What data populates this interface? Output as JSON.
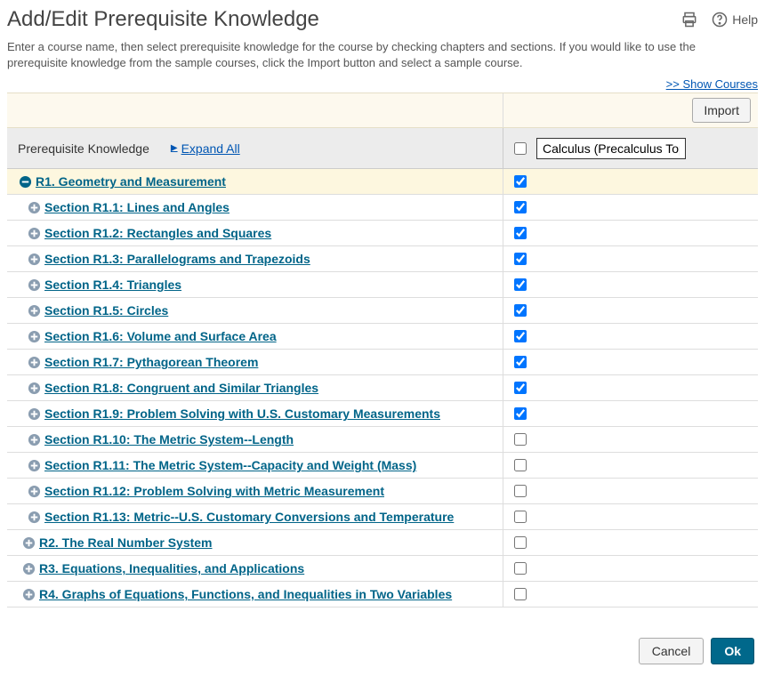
{
  "title": "Add/Edit Prerequisite Knowledge",
  "help_label": "Help",
  "description": "Enter a course name, then select prerequisite knowledge for the course by checking chapters and sections. If you would like to use the prerequisite knowledge from the sample courses, click the Import button and select a sample course.",
  "show_courses_label": ">> Show Courses",
  "import_label": "Import",
  "prereq_header": "Prerequisite Knowledge",
  "expand_all_label": "Expand All",
  "course_input_value": "Calculus (Precalculus Topics)",
  "tree": [
    {
      "type": "chapter",
      "expanded": true,
      "label": "R1. Geometry and Measurement",
      "checked": true
    },
    {
      "type": "section",
      "label": "Section R1.1: Lines and Angles",
      "checked": true
    },
    {
      "type": "section",
      "label": "Section R1.2: Rectangles and Squares",
      "checked": true
    },
    {
      "type": "section",
      "label": "Section R1.3: Parallelograms and Trapezoids",
      "checked": true
    },
    {
      "type": "section",
      "label": "Section R1.4: Triangles",
      "checked": true
    },
    {
      "type": "section",
      "label": "Section R1.5: Circles",
      "checked": true
    },
    {
      "type": "section",
      "label": "Section R1.6: Volume and Surface Area",
      "checked": true
    },
    {
      "type": "section",
      "label": "Section R1.7: Pythagorean Theorem",
      "checked": true
    },
    {
      "type": "section",
      "label": "Section R1.8: Congruent and Similar Triangles",
      "checked": true
    },
    {
      "type": "section",
      "label": "Section R1.9: Problem Solving with U.S. Customary Measurements",
      "checked": true
    },
    {
      "type": "section",
      "label": "Section R1.10: The Metric System--Length",
      "checked": false
    },
    {
      "type": "section",
      "label": "Section R1.11: The Metric System--Capacity and Weight (Mass)",
      "checked": false
    },
    {
      "type": "section",
      "label": "Section R1.12: Problem Solving with Metric Measurement",
      "checked": false
    },
    {
      "type": "section",
      "label": "Section R1.13: Metric--U.S. Customary Conversions and Temperature",
      "checked": false
    },
    {
      "type": "chapter",
      "expanded": false,
      "label": "R2. The Real Number System",
      "checked": false
    },
    {
      "type": "chapter",
      "expanded": false,
      "label": "R3. Equations, Inequalities, and Applications",
      "checked": false
    },
    {
      "type": "chapter",
      "expanded": false,
      "label": "R4. Graphs of Equations, Functions, and Inequalities in Two Variables",
      "checked": false
    }
  ],
  "cancel_label": "Cancel",
  "ok_label": "Ok"
}
